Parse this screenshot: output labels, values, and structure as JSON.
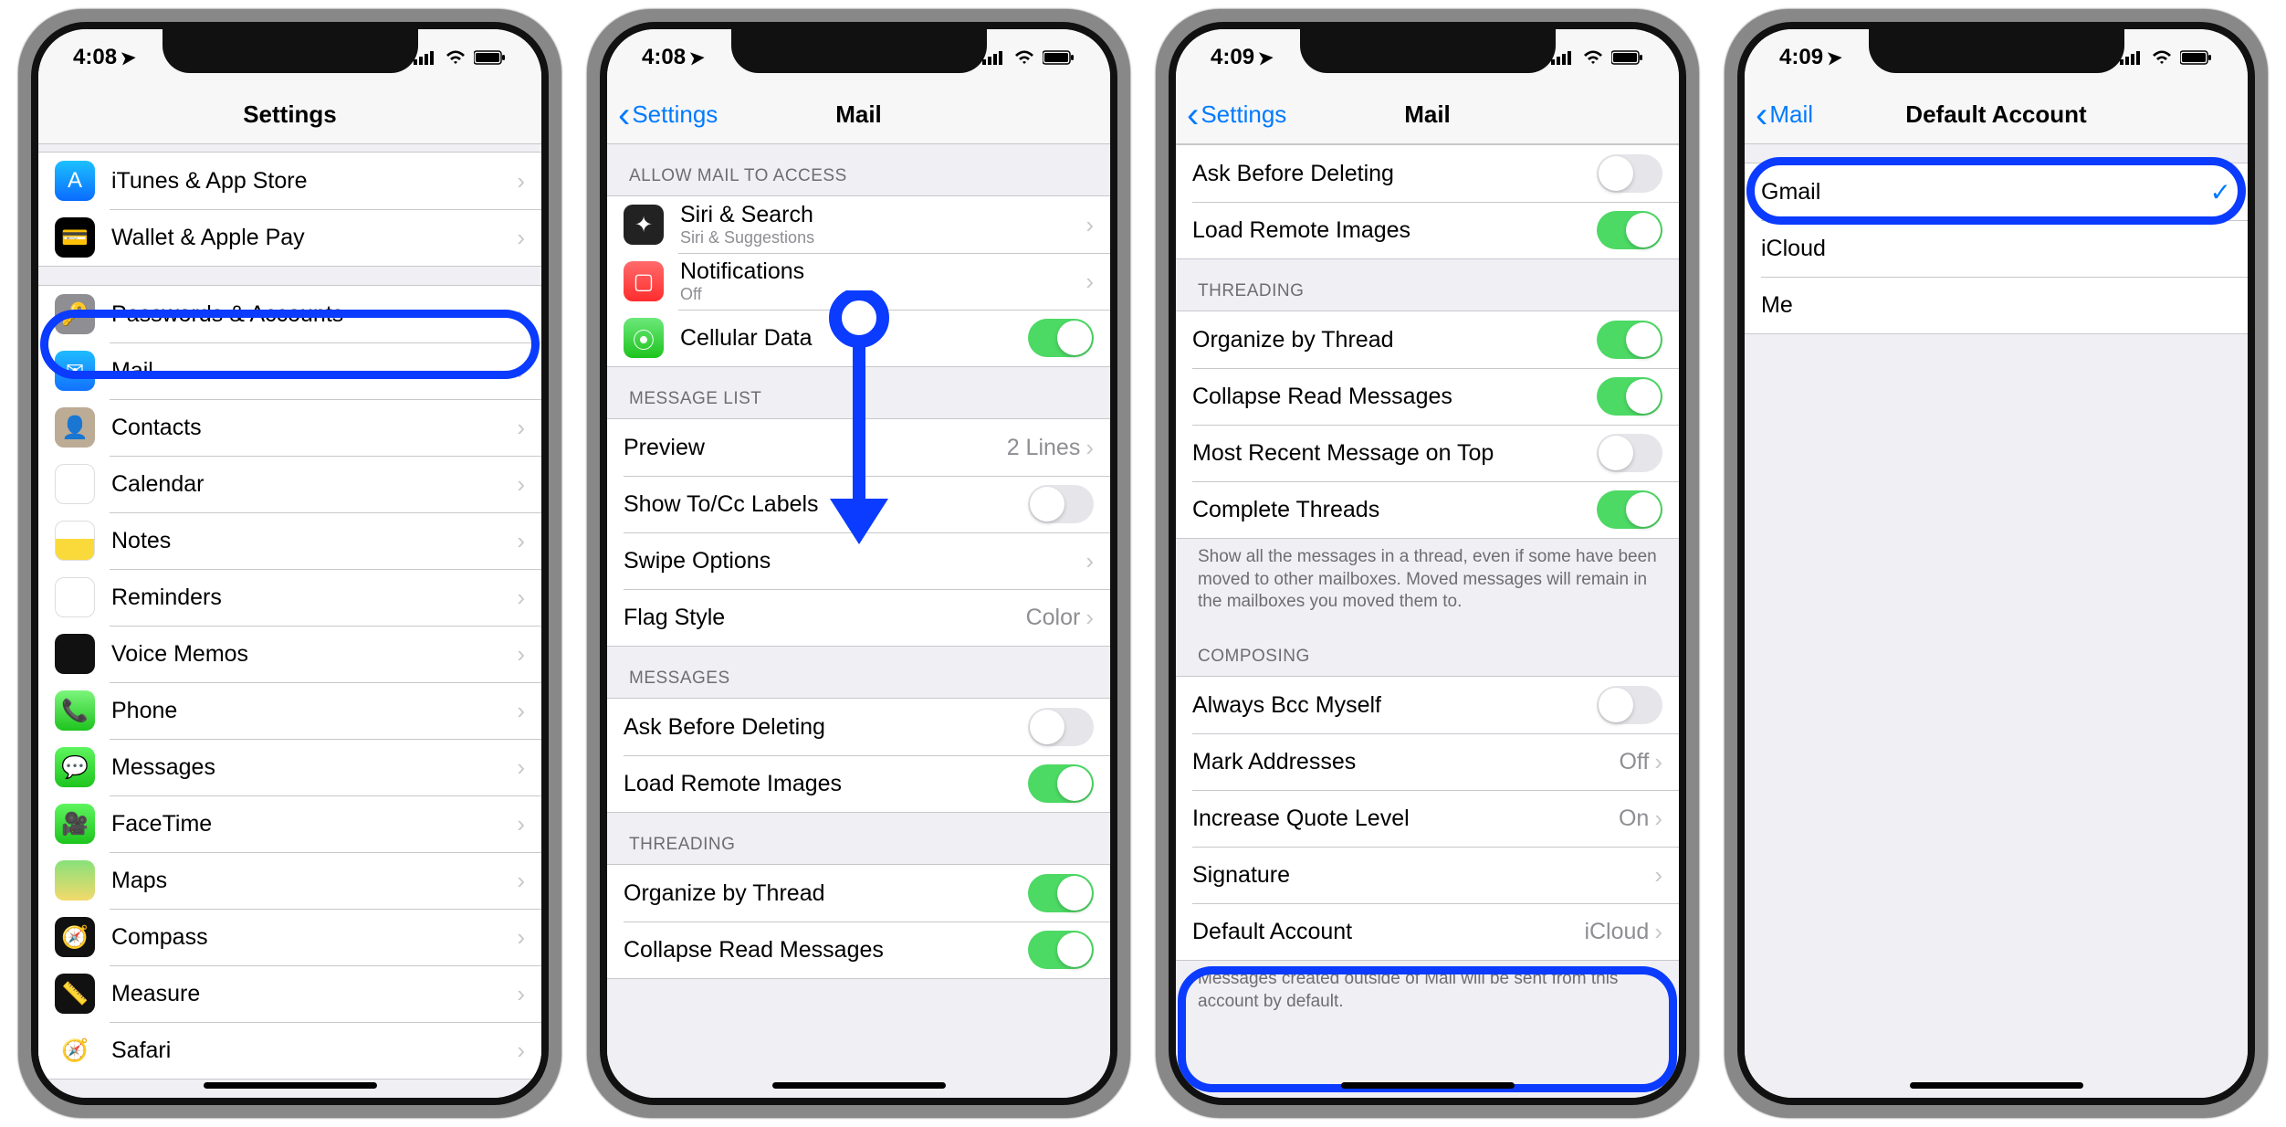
{
  "screens": [
    {
      "time": "4:08",
      "nav": {
        "title": "Settings",
        "back": null
      },
      "highlight_row_index": 2,
      "sections": [
        {
          "rows": [
            {
              "icon": "ic-appstore",
              "glyph": "A",
              "label": "iTunes & App Store",
              "type": "disclosure"
            },
            {
              "icon": "ic-wallet",
              "glyph": "💳",
              "label": "Wallet & Apple Pay",
              "type": "disclosure"
            }
          ]
        },
        {
          "rows": [
            {
              "icon": "ic-passwords",
              "glyph": "🔑",
              "label": "Passwords & Accounts",
              "type": "disclosure"
            },
            {
              "icon": "ic-mail",
              "glyph": "✉︎",
              "label": "Mail",
              "type": "disclosure"
            },
            {
              "icon": "ic-contacts",
              "glyph": "👤",
              "label": "Contacts",
              "type": "disclosure"
            },
            {
              "icon": "ic-calendar",
              "glyph": "",
              "label": "Calendar",
              "type": "disclosure"
            },
            {
              "icon": "ic-notes",
              "glyph": "",
              "label": "Notes",
              "type": "disclosure"
            },
            {
              "icon": "ic-reminders",
              "glyph": "",
              "label": "Reminders",
              "type": "disclosure"
            },
            {
              "icon": "ic-voice",
              "glyph": "",
              "label": "Voice Memos",
              "type": "disclosure"
            },
            {
              "icon": "ic-phone",
              "glyph": "📞",
              "label": "Phone",
              "type": "disclosure"
            },
            {
              "icon": "ic-messages",
              "glyph": "💬",
              "label": "Messages",
              "type": "disclosure"
            },
            {
              "icon": "ic-facetime",
              "glyph": "🎥",
              "label": "FaceTime",
              "type": "disclosure"
            },
            {
              "icon": "ic-maps",
              "glyph": "",
              "label": "Maps",
              "type": "disclosure"
            },
            {
              "icon": "ic-compass",
              "glyph": "🧭",
              "label": "Compass",
              "type": "disclosure"
            },
            {
              "icon": "ic-measure",
              "glyph": "📏",
              "label": "Measure",
              "type": "disclosure"
            },
            {
              "icon": "ic-safari",
              "glyph": "🧭",
              "label": "Safari",
              "type": "disclosure"
            }
          ]
        }
      ]
    },
    {
      "time": "4:08",
      "nav": {
        "title": "Mail",
        "back": "Settings"
      },
      "show_scroll_arrow": true,
      "sections": [
        {
          "header": "ALLOW MAIL TO ACCESS",
          "rows": [
            {
              "icon": "ic-siri",
              "glyph": "✦",
              "label": "Siri & Search",
              "sublabel": "Siri & Suggestions",
              "type": "disclosure"
            },
            {
              "icon": "ic-notif",
              "glyph": "▢",
              "label": "Notifications",
              "sublabel": "Off",
              "type": "disclosure"
            },
            {
              "icon": "ic-cellular",
              "glyph": "⦿",
              "label": "Cellular Data",
              "type": "toggle",
              "toggle": true
            }
          ]
        },
        {
          "header": "MESSAGE LIST",
          "rows": [
            {
              "label": "Preview",
              "value": "2 Lines",
              "type": "disclosure"
            },
            {
              "label": "Show To/Cc Labels",
              "type": "toggle",
              "toggle": false
            },
            {
              "label": "Swipe Options",
              "type": "disclosure"
            },
            {
              "label": "Flag Style",
              "value": "Color",
              "type": "disclosure"
            }
          ]
        },
        {
          "header": "MESSAGES",
          "rows": [
            {
              "label": "Ask Before Deleting",
              "type": "toggle",
              "toggle": false
            },
            {
              "label": "Load Remote Images",
              "type": "toggle",
              "toggle": true
            }
          ]
        },
        {
          "header": "THREADING",
          "rows": [
            {
              "label": "Organize by Thread",
              "type": "toggle",
              "toggle": true
            },
            {
              "label": "Collapse Read Messages",
              "type": "toggle",
              "toggle": true
            }
          ]
        }
      ]
    },
    {
      "time": "4:09",
      "nav": {
        "title": "Mail",
        "back": "Settings"
      },
      "highlight_bottom": true,
      "sections": [
        {
          "rows": [
            {
              "label": "Ask Before Deleting",
              "type": "toggle",
              "toggle": false
            },
            {
              "label": "Load Remote Images",
              "type": "toggle",
              "toggle": true
            }
          ]
        },
        {
          "header": "THREADING",
          "rows": [
            {
              "label": "Organize by Thread",
              "type": "toggle",
              "toggle": true
            },
            {
              "label": "Collapse Read Messages",
              "type": "toggle",
              "toggle": true
            },
            {
              "label": "Most Recent Message on Top",
              "type": "toggle",
              "toggle": false
            },
            {
              "label": "Complete Threads",
              "type": "toggle",
              "toggle": true
            }
          ],
          "footer": "Show all the messages in a thread, even if some have been moved to other mailboxes. Moved messages will remain in the mailboxes you moved them to."
        },
        {
          "header": "COMPOSING",
          "rows": [
            {
              "label": "Always Bcc Myself",
              "type": "toggle",
              "toggle": false
            },
            {
              "label": "Mark Addresses",
              "value": "Off",
              "type": "disclosure"
            },
            {
              "label": "Increase Quote Level",
              "value": "On",
              "type": "disclosure"
            },
            {
              "label": "Signature",
              "type": "disclosure"
            },
            {
              "label": "Default Account",
              "value": "iCloud",
              "type": "disclosure"
            }
          ],
          "footer": "Messages created outside of Mail will be sent from this account by default."
        }
      ]
    },
    {
      "time": "4:09",
      "nav": {
        "title": "Default Account",
        "back": "Mail"
      },
      "highlight_row_index": 0,
      "sections": [
        {
          "rows": [
            {
              "label": "Gmail",
              "type": "check",
              "checked": true
            },
            {
              "label": "iCloud",
              "type": "check",
              "checked": false
            },
            {
              "label": "Me",
              "type": "check",
              "checked": false
            }
          ]
        }
      ]
    }
  ]
}
